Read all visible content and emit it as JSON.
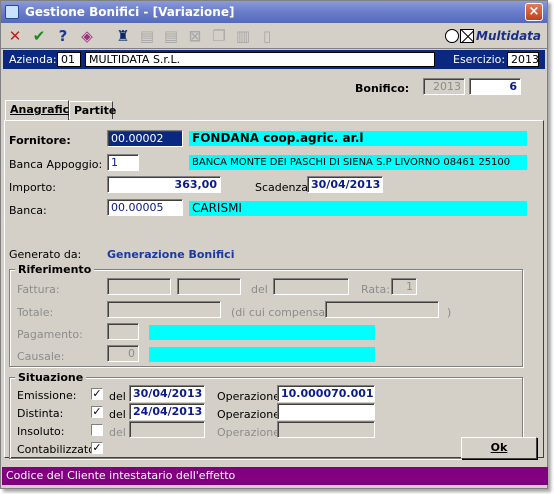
{
  "window": {
    "title": "Gestione Bonifici - [Variazione]",
    "close_glyph": "×"
  },
  "toolbar": {
    "icons": [
      "cancel-icon",
      "confirm-icon",
      "help-icon",
      "tag-icon",
      "binoculars-icon",
      "first-record-icon",
      "prev-record-icon",
      "delete-record-icon",
      "copy-icon",
      "paste-icon",
      "new-document-icon"
    ],
    "logo_text": "Multidata"
  },
  "company_bar": {
    "azienda_label": "Azienda:",
    "azienda_code": "01",
    "azienda_name": "MULTIDATA S.r.L.",
    "esercizio_label": "Esercizio:",
    "esercizio_value": "2013"
  },
  "bonifico": {
    "label": "Bonifico:",
    "anno": "2013",
    "numero": "6"
  },
  "tabs": [
    {
      "label": "Anagrafica",
      "active": true
    },
    {
      "label": "Partite",
      "active": false
    }
  ],
  "form": {
    "fornitore_label": "Fornitore:",
    "fornitore_code": "00.00002",
    "fornitore_name": "FONDANA coop.agric. ar.l",
    "banca_appoggio_label": "Banca Appoggio:",
    "banca_appoggio_code": "1",
    "banca_appoggio_name": "BANCA MONTE DEI PASCHI DI SIENA S.P LIVORNO 08461 25100",
    "importo_label": "Importo:",
    "importo_value": "363,00",
    "scadenza_label": "Scadenza:",
    "scadenza_value": "30/04/2013",
    "banca_label": "Banca:",
    "banca_code": "00.00005",
    "banca_name": "CARISMI",
    "generato_label": "Generato da:",
    "generato_value": "Generazione Bonifici"
  },
  "riferimento": {
    "title": "Riferimento",
    "fattura_label": "Fattura:",
    "del_label": "del",
    "rata_label": "Rata:",
    "rata_value": "1",
    "totale_label": "Totale:",
    "compensato_label": "(di cui compensato:",
    "compensato_close": ")",
    "pagamento_label": "Pagamento:",
    "causale_label": "Causale:",
    "causale_value": "0"
  },
  "situazione": {
    "title": "Situazione",
    "emissione_label": "Emissione:",
    "emissione_checked": true,
    "emissione_del": "del",
    "emissione_date": "30/04/2013",
    "emissione_operazione_label": "Operazione:",
    "emissione_operazione_value": "10.000070.001",
    "distinta_label": "Distinta:",
    "distinta_checked": true,
    "distinta_del": "del",
    "distinta_date": "24/04/2013",
    "distinta_operazione_label": "Operazione:",
    "insoluto_label": "Insoluto:",
    "insoluto_checked": false,
    "insoluto_del": "del",
    "insoluto_operazione_label": "Operazione:",
    "contabilizzato_label": "Contabilizzato:",
    "contabilizzato_checked": true,
    "check_glyph": "✓"
  },
  "buttons": {
    "ok_label": "Ok"
  },
  "status_bar": {
    "text": "Codice del Cliente intestatario dell'effetto"
  },
  "colors": {
    "title_bar": "#6b7fcc",
    "company_bar": "#0a2880",
    "cyan_field": "#00ffff",
    "status_bar": "#800080",
    "link_blue": "#1a3aa0"
  }
}
